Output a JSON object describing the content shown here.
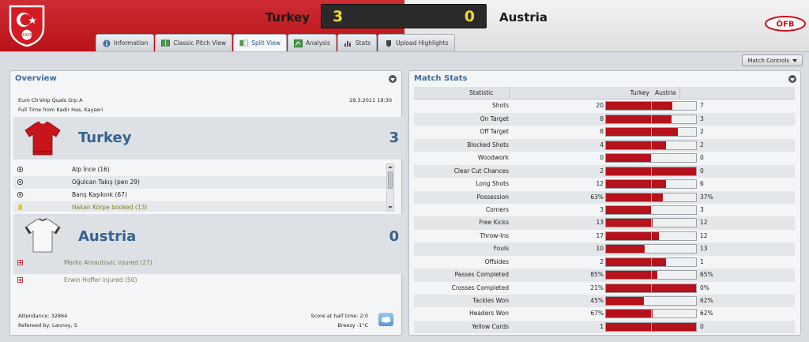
{
  "header": {
    "home_team": "Turkey",
    "away_team": "Austria",
    "home_score": "3",
    "away_score": "0",
    "crest_text": "1923",
    "away_badge_text": "ÖFB"
  },
  "tabs": [
    {
      "label": "Information",
      "icon": "info-icon"
    },
    {
      "label": "Classic Pitch View",
      "icon": "pitch-icon"
    },
    {
      "label": "Split View",
      "icon": "split-view-icon",
      "active": true
    },
    {
      "label": "Analysis",
      "icon": "analysis-icon"
    },
    {
      "label": "Stats",
      "icon": "stats-icon"
    },
    {
      "label": "Upload Highlights",
      "icon": "upload-icon"
    }
  ],
  "match_controls_label": "Match Controls",
  "overview": {
    "title": "Overview",
    "competition": "Euro Ch'ship Quals Grp A",
    "date_time": "29.3.2011 19:30",
    "full_time": "Full Time from Kadir Has, Kayseri",
    "home": {
      "name": "Turkey",
      "score": "3",
      "events": [
        {
          "text": "Alp İnce (16)",
          "type": "goal"
        },
        {
          "text": "Oğulcan Takış (pen 29)",
          "type": "goal"
        },
        {
          "text": "Barış Kaşıkınk (67)",
          "type": "goal"
        },
        {
          "text": "Hakan Körpe booked (13)",
          "type": "booked"
        }
      ]
    },
    "away": {
      "name": "Austria",
      "score": "0",
      "events": [
        {
          "text": "Marko Arnautovic injured (27)",
          "type": "injured"
        },
        {
          "text": "Erwin Hoffer injured (50)",
          "type": "injured"
        }
      ]
    },
    "attendance": "Attendance: 32864",
    "referee": "Refereed by: Lannoy, S",
    "half_time": "Score at half time: 2:0",
    "weather": "Breezy -1°C"
  },
  "match_stats": {
    "title": "Match Stats",
    "headers": {
      "statistic": "Statistic",
      "home": "Turkey",
      "away": "Austria"
    },
    "rows": [
      {
        "label": "Shots",
        "home": "20",
        "away": "7",
        "home_share": 0.74
      },
      {
        "label": "On Target",
        "home": "8",
        "away": "3",
        "home_share": 0.73
      },
      {
        "label": "Off Target",
        "home": "8",
        "away": "2",
        "home_share": 0.8
      },
      {
        "label": "Blocked Shots",
        "home": "4",
        "away": "2",
        "home_share": 0.67
      },
      {
        "label": "Woodwork",
        "home": "0",
        "away": "0",
        "home_share": 0.5
      },
      {
        "label": "Clear Cut Chances",
        "home": "2",
        "away": "0",
        "home_share": 1.0
      },
      {
        "label": "Long Shots",
        "home": "12",
        "away": "6",
        "home_share": 0.67
      },
      {
        "label": "Possession",
        "home": "63%",
        "away": "37%",
        "home_share": 0.63
      },
      {
        "label": "Corners",
        "home": "3",
        "away": "3",
        "home_share": 0.5
      },
      {
        "label": "Free Kicks",
        "home": "13",
        "away": "12",
        "home_share": 0.52
      },
      {
        "label": "Throw-Ins",
        "home": "17",
        "away": "12",
        "home_share": 0.59
      },
      {
        "label": "Fouls",
        "home": "10",
        "away": "13",
        "home_share": 0.43
      },
      {
        "label": "Offsides",
        "home": "2",
        "away": "1",
        "home_share": 0.67
      },
      {
        "label": "Passes Completed",
        "home": "85%",
        "away": "65%",
        "home_share": 0.57
      },
      {
        "label": "Crosses Completed",
        "home": "21%",
        "away": "0%",
        "home_share": 1.0
      },
      {
        "label": "Tackles Won",
        "home": "45%",
        "away": "62%",
        "home_share": 0.42
      },
      {
        "label": "Headers Won",
        "home": "67%",
        "away": "62%",
        "home_share": 0.52
      },
      {
        "label": "Yellow Cards",
        "home": "1",
        "away": "0",
        "home_share": 1.0
      }
    ]
  }
}
